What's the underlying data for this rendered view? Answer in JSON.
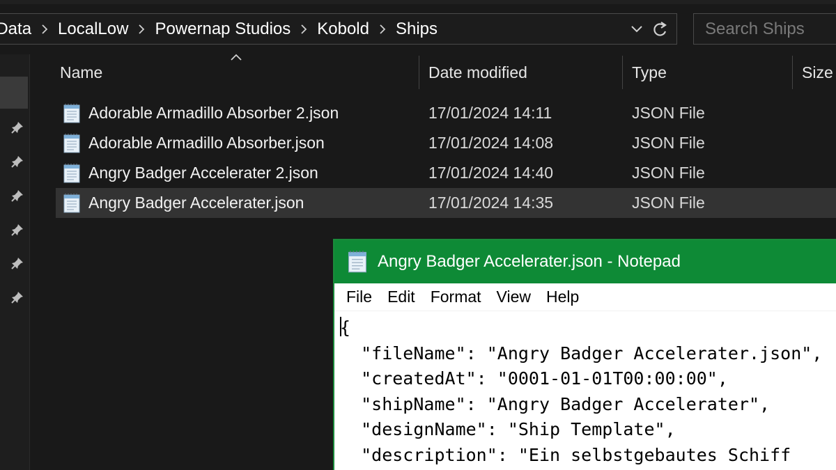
{
  "explorer": {
    "breadcrumb": [
      "pData",
      "LocalLow",
      "Powernap Studios",
      "Kobold",
      "Ships"
    ],
    "search_placeholder": "Search Ships",
    "columns": {
      "name": "Name",
      "date": "Date modified",
      "type": "Type",
      "size": "Size"
    },
    "files": [
      {
        "name": "Adorable Armadillo Absorber 2.json",
        "date": "17/01/2024 14:11",
        "type": "JSON File",
        "selected": false
      },
      {
        "name": "Adorable Armadillo Absorber.json",
        "date": "17/01/2024 14:08",
        "type": "JSON File",
        "selected": false
      },
      {
        "name": "Angry Badger Accelerater 2.json",
        "date": "17/01/2024 14:40",
        "type": "JSON File",
        "selected": false
      },
      {
        "name": "Angry Badger Accelerater.json",
        "date": "17/01/2024 14:35",
        "type": "JSON File",
        "selected": true
      }
    ],
    "icons": [
      "chevron-right-icon",
      "dropdown-icon",
      "refresh-icon",
      "pin-icon",
      "notepad-file-icon",
      "sort-up-icon"
    ]
  },
  "notepad": {
    "title": "Angry Badger Accelerater.json - Notepad",
    "menu": [
      "File",
      "Edit",
      "Format",
      "View",
      "Help"
    ],
    "lines": [
      "{",
      "  \"fileName\": \"Angry Badger Accelerater.json\",",
      "  \"createdAt\": \"0001-01-01T00:00:00\",",
      "  \"shipName\": \"Angry Badger Accelerater\",",
      "  \"designName\": \"Ship Template\",",
      "  \"description\": \"Ein selbstgebautes Schiff"
    ]
  },
  "colors": {
    "explorer_bg": "#191919",
    "selected_row": "#333333",
    "notepad_titlebar": "#0e8a36",
    "notepad_bg": "#ffffff"
  }
}
